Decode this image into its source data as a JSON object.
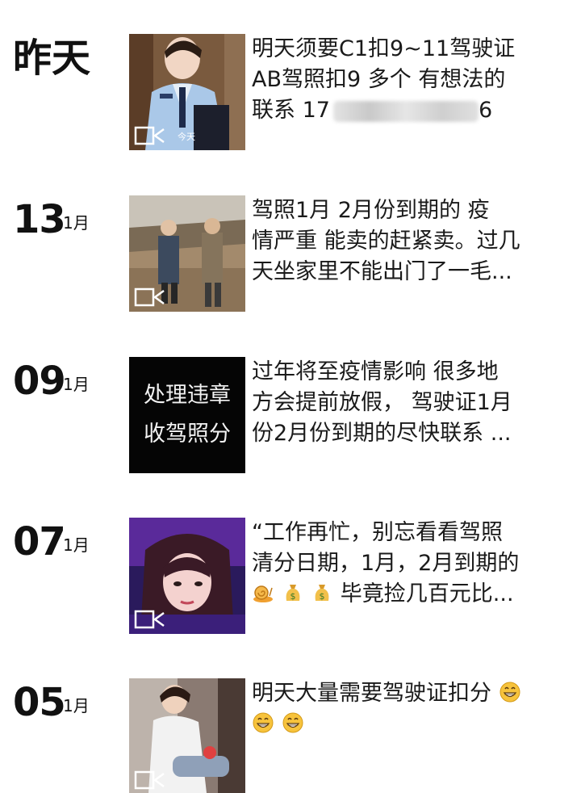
{
  "entries": [
    {
      "date": "昨天",
      "month": "",
      "lines": [
        "明天须要C1扣9~11驾驶证",
        "AB驾照扣9   多个  有想法的",
        "联系   17"
      ],
      "phone_tail": "6",
      "thumb_caption": "今天",
      "has_video": true
    },
    {
      "date": "13",
      "month": "1月",
      "lines": [
        "驾照1月   2月份到期的    疫",
        "情严重 能卖的赶紧卖。过几",
        "天坐家里不能出门了一毛..."
      ],
      "has_video": true
    },
    {
      "date": "09",
      "month": "1月",
      "lines": [
        "过年将至疫情影响    很多地",
        "方会提前放假， 驾驶证1月",
        "份2月份到期的尽快联系   ..."
      ],
      "thumb_text": [
        "处理违章",
        "收驾照分"
      ],
      "has_video": false
    },
    {
      "date": "07",
      "month": "1月",
      "lines": [
        "“工作再忙，别忘看看驾照",
        "清分日期，1月，2月到期的",
        "毕竟捡几百元比..."
      ],
      "emojis": [
        "snail-emoji",
        "money-bag-emoji",
        "money-bag-emoji"
      ],
      "has_video": true
    },
    {
      "date": "05",
      "month": "1月",
      "lines": [
        "明天大量需要驾驶证扣分"
      ],
      "emojis": [
        "grinning-emoji",
        "grinning-emoji",
        "grinning-emoji"
      ],
      "has_video": true
    }
  ]
}
